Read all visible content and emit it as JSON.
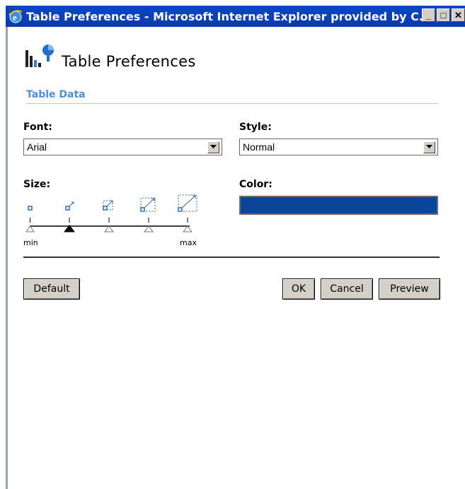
{
  "window": {
    "title": "Table Preferences - Microsoft Internet Explorer provided by C...",
    "controls": [
      "_",
      "□",
      "✕"
    ]
  },
  "page": {
    "title": "Table Preferences",
    "section": "Table Data"
  },
  "font": {
    "label": "Font:",
    "value": "Arial"
  },
  "style": {
    "label": "Style:",
    "value": "Normal"
  },
  "size": {
    "label": "Size:",
    "min_label": "min",
    "max_label": "max",
    "levels": 5,
    "selected_index": 1
  },
  "color": {
    "label": "Color:",
    "value": "#0b4599"
  },
  "buttons": {
    "default": "Default",
    "ok": "OK",
    "cancel": "Cancel",
    "preview": "Preview"
  }
}
